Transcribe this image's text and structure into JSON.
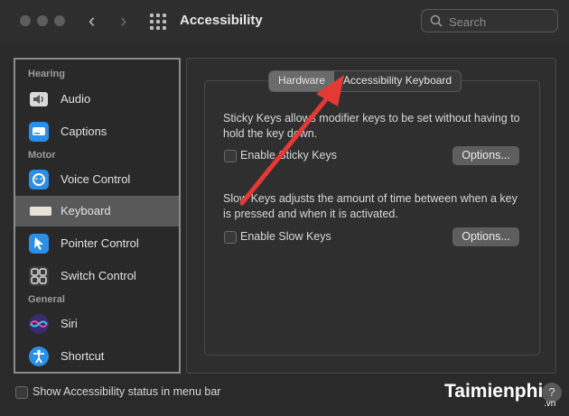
{
  "window": {
    "title": "Accessibility",
    "back_icon": "chevron-left-icon",
    "forward_icon": "chevron-right-icon"
  },
  "search": {
    "placeholder": "Search"
  },
  "sidebar": {
    "sections": [
      {
        "label": "Hearing"
      },
      {
        "label": "Motor"
      },
      {
        "label": "General"
      }
    ],
    "items": [
      {
        "label": "Audio",
        "icon": "speaker-icon"
      },
      {
        "label": "Captions",
        "icon": "captions-icon"
      },
      {
        "label": "Voice Control",
        "icon": "voice-control-icon"
      },
      {
        "label": "Keyboard",
        "icon": "keyboard-icon",
        "selected": true
      },
      {
        "label": "Pointer Control",
        "icon": "pointer-icon"
      },
      {
        "label": "Switch Control",
        "icon": "switch-control-icon"
      },
      {
        "label": "Siri",
        "icon": "siri-icon"
      },
      {
        "label": "Shortcut",
        "icon": "accessibility-shortcut-icon"
      }
    ]
  },
  "tabs": [
    {
      "label": "Hardware",
      "active": true
    },
    {
      "label": "Accessibility Keyboard",
      "active": false
    }
  ],
  "sticky": {
    "description": "Sticky Keys allows modifier keys to be set without having to hold the key down.",
    "checkbox_label": "Enable Sticky Keys",
    "checked": false,
    "options_label": "Options..."
  },
  "slow": {
    "description": "Slow Keys adjusts the amount of time between when a key is pressed and when it is activated.",
    "checkbox_label": "Enable Slow Keys",
    "checked": false,
    "options_label": "Options..."
  },
  "footer": {
    "status_label": "Show Accessibility status in menu bar",
    "checked": false,
    "help": "?"
  },
  "watermark": {
    "text": "Taimienphi",
    "suffix": ".vn"
  },
  "colors": {
    "accent_blue": "#1e88e5",
    "arrow_red": "#e53935"
  }
}
